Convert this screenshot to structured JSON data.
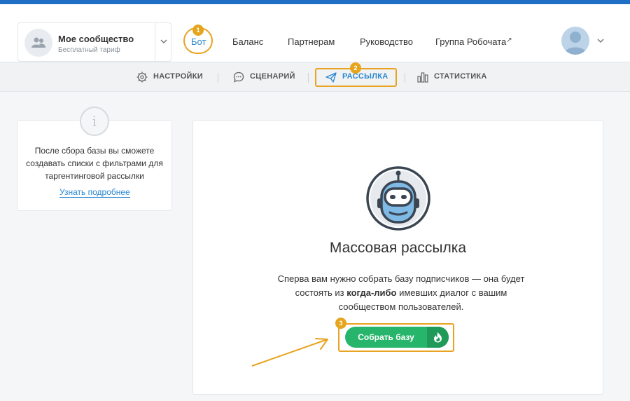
{
  "community": {
    "name": "Мое сообщество",
    "plan": "Бесплатный тариф"
  },
  "nav": {
    "items": [
      {
        "label": "Бот",
        "active": true
      },
      {
        "label": "Баланс"
      },
      {
        "label": "Партнерам"
      },
      {
        "label": "Руководство"
      },
      {
        "label": "Группа Робочата"
      }
    ],
    "external_icon": "↗"
  },
  "subnav": {
    "items": [
      {
        "label": "НАСТРОЙКИ",
        "icon": "gear-icon"
      },
      {
        "label": "СЦЕНАРИЙ",
        "icon": "chat-icon"
      },
      {
        "label": "РАССЫЛКА",
        "icon": "paper-plane-icon",
        "active": true
      },
      {
        "label": "СТАТИСТИКА",
        "icon": "bar-chart-icon"
      }
    ]
  },
  "badges": [
    "1",
    "2",
    "3"
  ],
  "info": {
    "icon_glyph": "i",
    "text": "После сбора базы вы сможете создавать списки с фильтрами для таргентинговой рассылки",
    "link": "Узнать подробнее"
  },
  "main": {
    "title": "Массовая рассылка",
    "desc_before": "Сперва вам нужно собрать базу подписчиков — она будет состоять из ",
    "desc_bold": "когда-либо",
    "desc_after": " имевших диалог с вашим сообществом пользователей.",
    "button_label": "Собрать базу"
  },
  "colors": {
    "accent": "#2b87d1",
    "highlight": "#e8a320",
    "button": "#27b46b",
    "button_dark": "#1f9a58",
    "top_bar": "#1e6fc5"
  }
}
